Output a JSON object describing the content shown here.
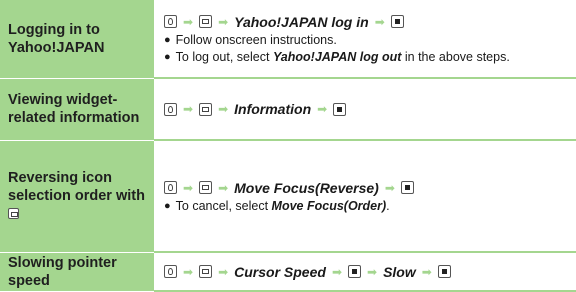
{
  "rows": [
    {
      "label": "Logging in to Yahoo!JAPAN",
      "op": "Yahoo!JAPAN log in",
      "bullet1": "Follow onscreen instructions.",
      "bullet2_pre": "To log out, select ",
      "bullet2_em": "Yahoo!JAPAN log out",
      "bullet2_post": " in the above steps."
    },
    {
      "label": "Viewing widget-related information",
      "op": "Information"
    },
    {
      "label_pre": "Reversing icon selection order with",
      "op": "Move Focus(Reverse)",
      "bullet_pre": "To cancel, select ",
      "bullet_em": "Move Focus(Order)",
      "bullet_post": "."
    },
    {
      "label": "Slowing pointer speed",
      "op1": "Cursor Speed",
      "op2": "Slow"
    }
  ],
  "arrow_glyph": "➡",
  "bullet_glyph": "●",
  "colors": {
    "label_bg": "#a4d68f",
    "arrow": "#a4d68f",
    "text": "#1a1a1a"
  }
}
